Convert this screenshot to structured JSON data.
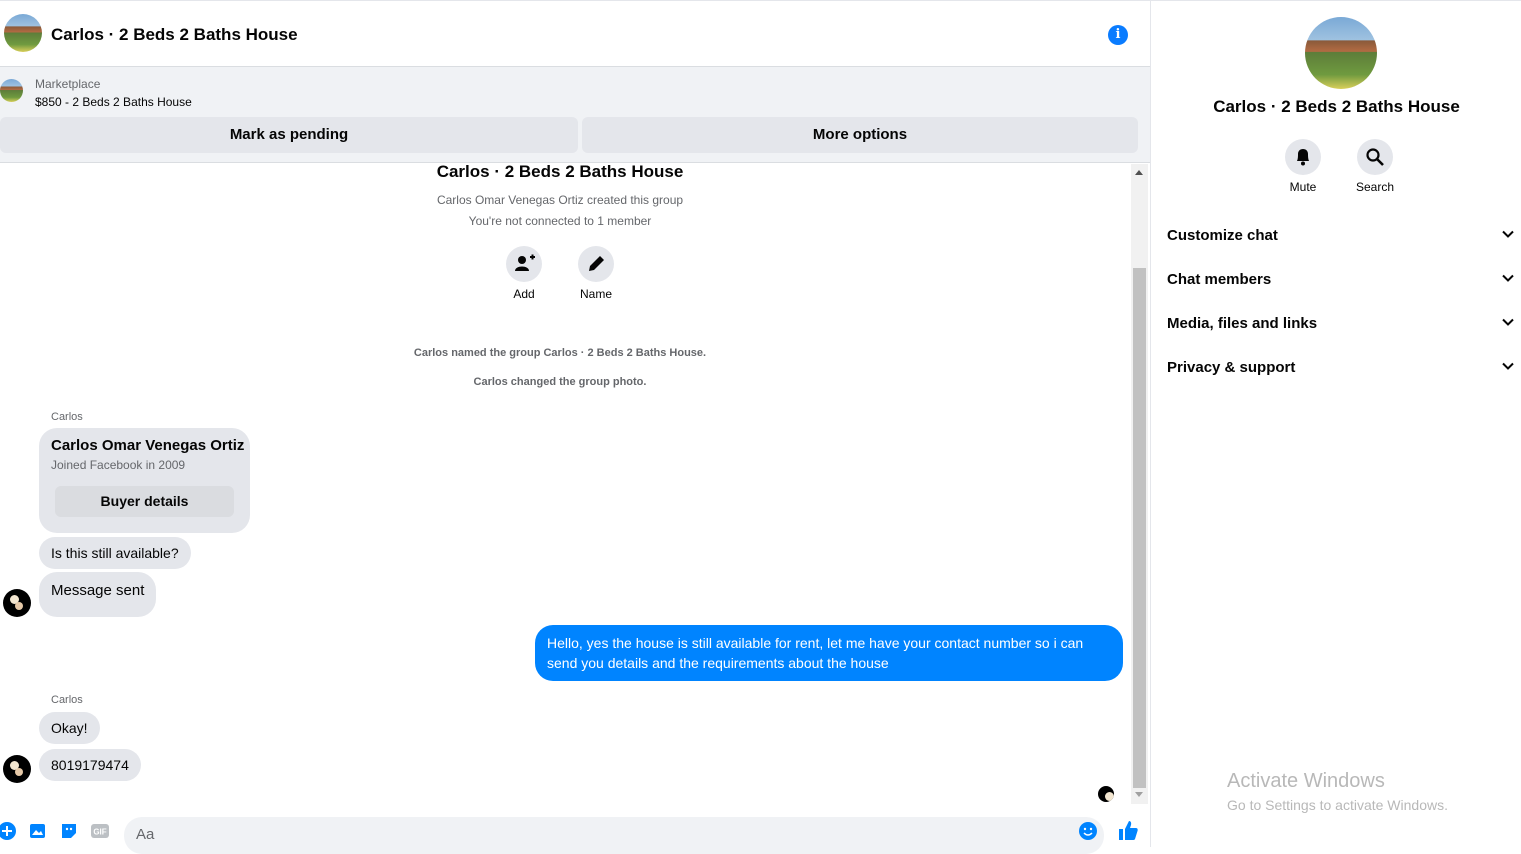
{
  "header": {
    "title": "Carlos · 2 Beds 2 Baths House",
    "info_icon": "info-icon"
  },
  "marketplace": {
    "label": "Marketplace",
    "listing": "$850 - 2 Beds 2 Baths House",
    "mark_pending": "Mark as pending",
    "more_options": "More options"
  },
  "thread": {
    "title": "Carlos · 2 Beds 2 Baths House",
    "created": "Carlos Omar Venegas Ortiz created this group",
    "connected": "You're not connected to 1 member",
    "add_label": "Add",
    "name_label": "Name",
    "sys1": "Carlos named the group Carlos · 2 Beds 2 Baths House.",
    "sys2": "Carlos changed the group photo.",
    "sender1": "Carlos",
    "card_name": "Carlos Omar Venegas Ortiz",
    "card_sub": "Joined Facebook in 2009",
    "card_button": "Buyer details",
    "msg1": "Is this still available?",
    "msg2": "Message sent",
    "msg_out": "Hello, yes the house is still available for rent, let me have your contact number so i can send you details and the requirements about the house",
    "sender2": "Carlos",
    "msg3": "Okay!",
    "msg4": "8019179474"
  },
  "composer": {
    "placeholder": "Aa"
  },
  "side": {
    "title": "Carlos · 2 Beds 2 Baths House",
    "mute": "Mute",
    "search": "Search",
    "sections": [
      "Customize chat",
      "Chat members",
      "Media, files and links",
      "Privacy & support"
    ]
  },
  "watermark": {
    "line1": "Activate Windows",
    "line2": "Go to Settings to activate Windows."
  },
  "colors": {
    "accent": "#0084ff",
    "bubble_in": "#e4e6eb",
    "panel_bg": "#f0f2f5"
  }
}
